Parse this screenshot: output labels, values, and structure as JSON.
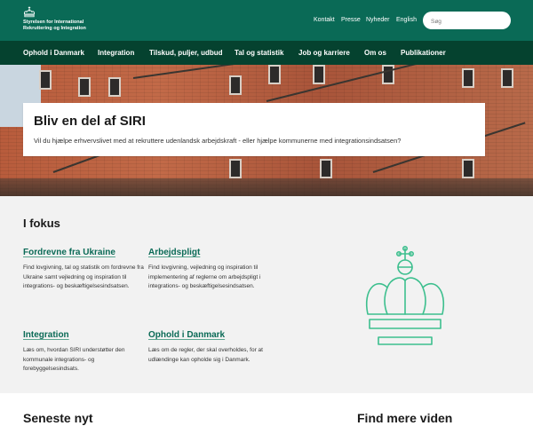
{
  "header": {
    "logo_line1": "Styrelsen for International",
    "logo_line2": "Rekruttering og Integration",
    "links": [
      "Kontakt",
      "Presse",
      "Nyheder",
      "English"
    ],
    "search_placeholder": "Søg"
  },
  "nav": {
    "items": [
      "Ophold i Danmark",
      "Integration",
      "Tilskud, puljer, udbud",
      "Tal og statistik",
      "Job og karriere",
      "Om os",
      "Publikationer"
    ]
  },
  "hero": {
    "title": "Bliv en del af SIRI",
    "subtitle": "Vil du hjælpe erhvervslivet med at rekruttere udenlandsk arbejdskraft - eller hjælpe kommunerne med integrationsindsatsen?"
  },
  "focus": {
    "heading": "I fokus",
    "items": [
      {
        "title": "Fordrevne fra Ukraine",
        "text": "Find lovgivning, tal og statistik om fordrevne fra Ukraine samt vejledning og inspiration til integrations- og beskæftigelsesindsatsen."
      },
      {
        "title": "Arbejdspligt",
        "text": "Find lovgivning, vejledning og inspiration til implementering af reglerne om arbejdspligt i integrations- og beskæftigelsesindsatsen."
      },
      {
        "title": "Integration",
        "text": "Læs om, hvordan SIRI understøtter den kommunale integrations- og forebyggelsesindsats."
      },
      {
        "title": "Ophold i Danmark",
        "text": "Læs om de regler, der skal overholdes, for at udlændinge kan opholde sig i Danmark."
      }
    ]
  },
  "bottom": {
    "left_heading": "Seneste nyt",
    "right_heading": "Find mere viden"
  },
  "colors": {
    "header_green": "#0a6a56",
    "nav_green": "#05422f",
    "link_green": "#0a6a56",
    "crown_outline": "#3dbf8e"
  }
}
